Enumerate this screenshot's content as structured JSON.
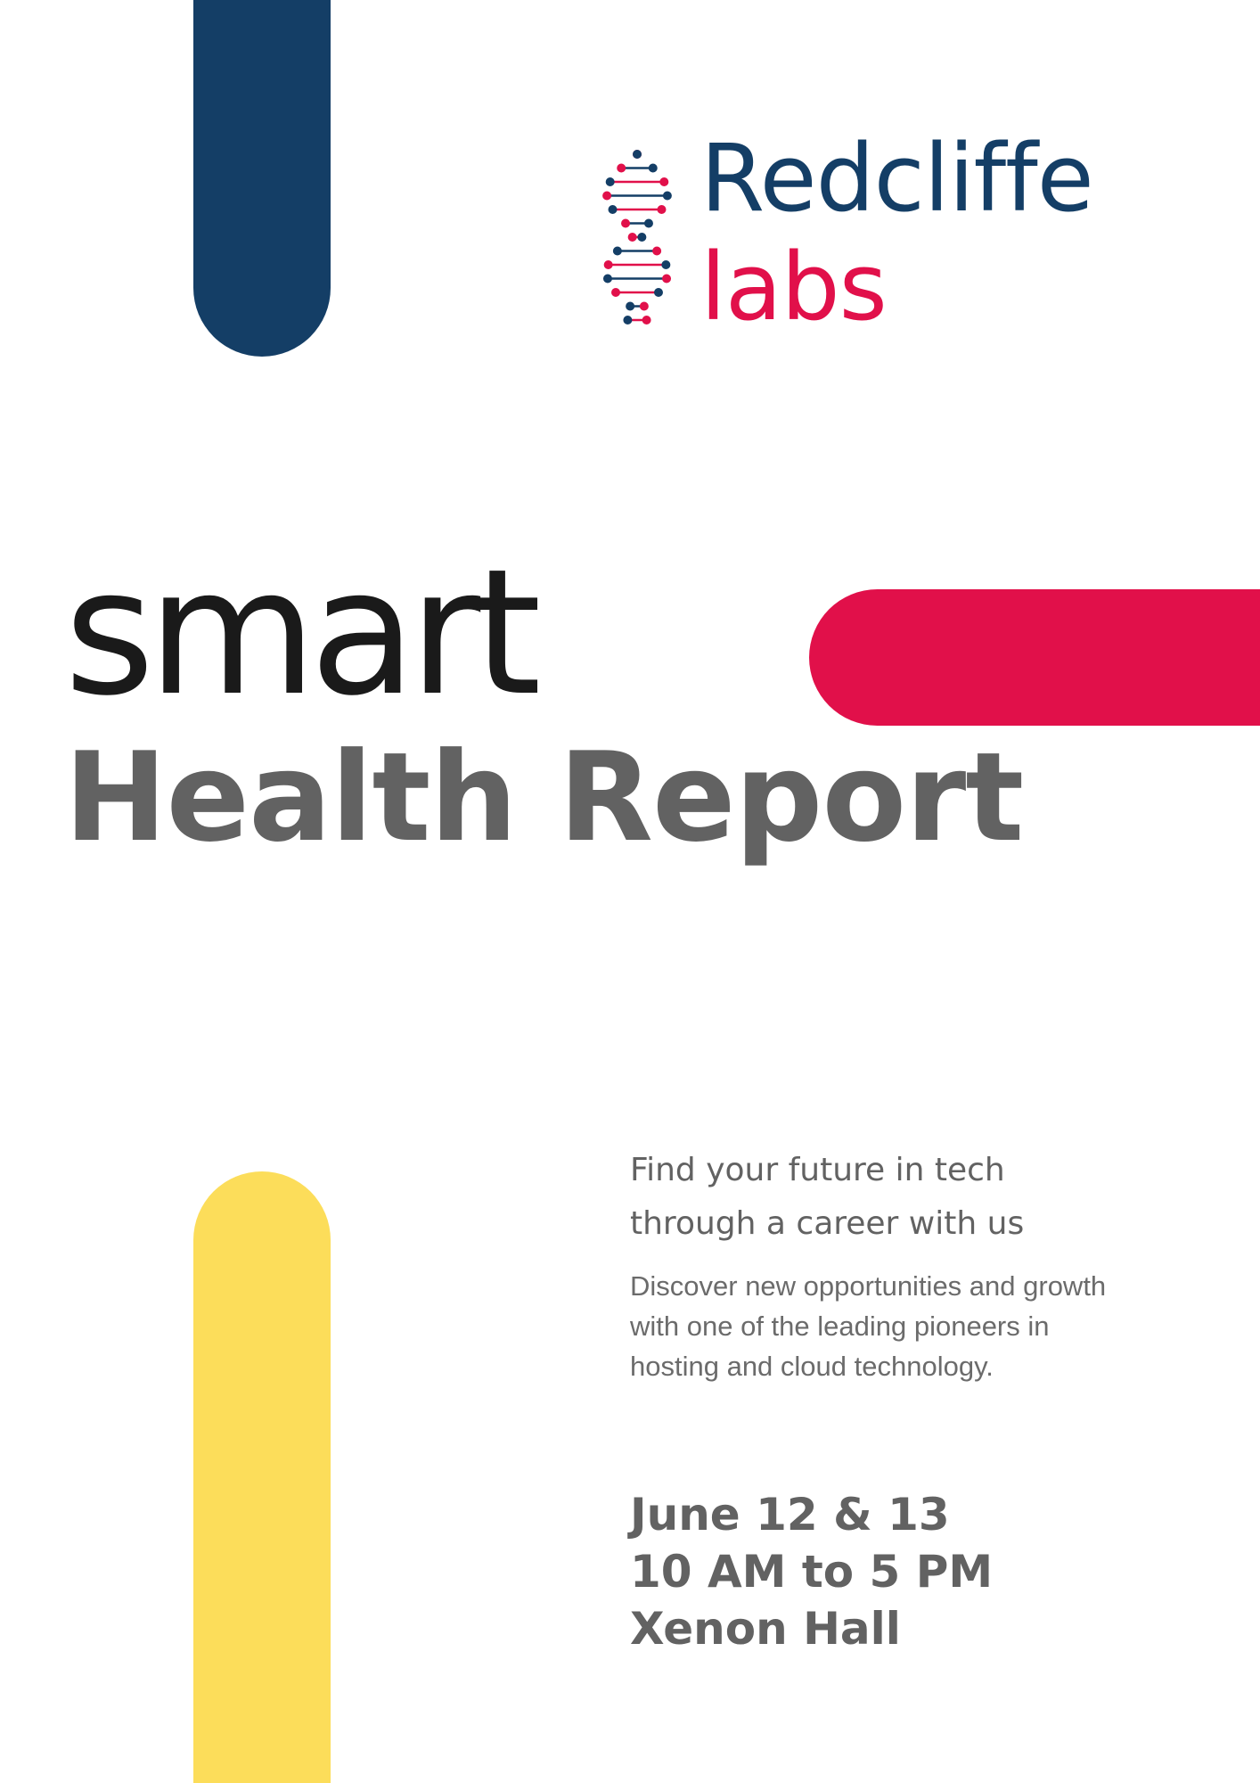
{
  "colors": {
    "navy": "#143e66",
    "crimson": "#e1104a",
    "yellow": "#fcdd5a",
    "dark_text": "#1a1a1a",
    "gray_text": "#626262",
    "body_text": "#6b6b6b"
  },
  "logo": {
    "icon": "dna-helix-icon",
    "word1": "Redcliffe",
    "word2": "labs"
  },
  "title": {
    "line1": "smart",
    "line2": "Health Report"
  },
  "tagline": {
    "line1": "Find your future in tech",
    "line2": "through a career with us"
  },
  "description": {
    "line1": "Discover new opportunities and growth",
    "line2": "with one of the leading pioneers in",
    "line3": "hosting and cloud technology."
  },
  "event": {
    "date": "June 12 & 13",
    "time": "10 AM to 5 PM",
    "venue": "Xenon Hall"
  }
}
